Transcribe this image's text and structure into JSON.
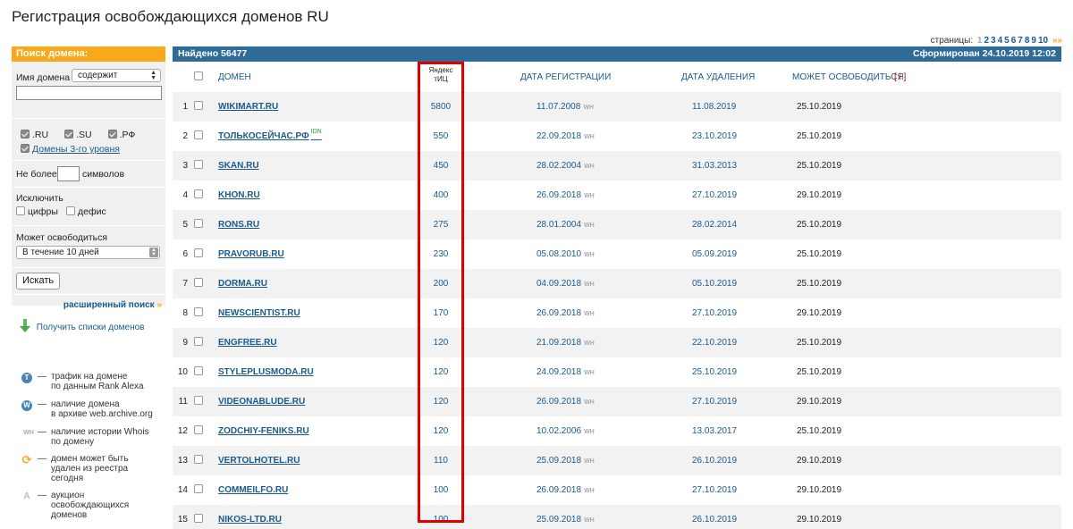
{
  "page": {
    "title": "Регистрация освобождающихся доменов RU"
  },
  "pager": {
    "label": "страницы:",
    "pages": [
      "1",
      "2",
      "3",
      "4",
      "5",
      "6",
      "7",
      "8",
      "9",
      "10"
    ],
    "current": "1",
    "next_icon": "»»"
  },
  "sidebar": {
    "header": "Поиск домена:",
    "domain_name_label": "Имя домена",
    "match_select": "содержит",
    "domain_input_value": "",
    "zones": [
      {
        "label": ".RU",
        "checked": true
      },
      {
        "label": ".SU",
        "checked": true
      },
      {
        "label": ".РФ",
        "checked": true
      }
    ],
    "third_level": {
      "label": "Домены 3-го уровня",
      "checked": true
    },
    "max_chars_prefix": "Не более",
    "max_chars_suffix": "символов",
    "max_chars_value": "",
    "exclude_label": "Исключить",
    "exclude_digits": "цифры",
    "exclude_hyphen": "дефис",
    "may_free_label": "Может освободиться",
    "period_select": "В течение 10 дней",
    "search_button": "Искать",
    "advanced_link": "расширенный поиск",
    "advanced_icon": "»",
    "download_link": "Получить списки доменов"
  },
  "legend": [
    {
      "icon": "T",
      "icon_name": "traffic-icon",
      "text": [
        "трафик на домене",
        "по данным Rank Alexa"
      ]
    },
    {
      "icon": "W",
      "icon_name": "archive-icon",
      "text": [
        "наличие домена",
        "в архиве web.archive.org"
      ]
    },
    {
      "icon": "WH",
      "icon_name": "whois-history-icon",
      "text": [
        "наличие истории Whois",
        "по домену"
      ]
    },
    {
      "icon": "⟳",
      "icon_name": "deleted-today-icon",
      "text": [
        "домен может быть",
        "удален из реестра",
        "сегодня"
      ]
    },
    {
      "icon": "A",
      "icon_name": "auction-icon",
      "text": [
        "аукцион",
        "освобождающихся",
        "доменов"
      ]
    }
  ],
  "legend_dash": "—",
  "results": {
    "found": "Найдено 56477",
    "generated": "Сформирован 24.10.2019 12:02",
    "headers": {
      "domain": "ДОМЕН",
      "tic_line1": "Яндекс",
      "tic_line2": "тИЦ",
      "reg_date": "ДАТА РЕГИСТРАЦИИ",
      "del_date": "ДАТА УДАЛЕНИЯ",
      "may_free": "МОЖЕТ ОСВОБОДИТЬСЯ",
      "info": "[ i ]"
    },
    "wh_badge": "WH",
    "rows": [
      {
        "n": "1",
        "domain": "WIKIMART.RU",
        "idn": "",
        "tic": "5800",
        "reg": "11.07.2008",
        "del": "11.08.2019",
        "free": "25.10.2019"
      },
      {
        "n": "2",
        "domain": "ТОЛЬКОСЕЙЧАС.РФ",
        "idn": "idn",
        "tic": "550",
        "reg": "22.09.2018",
        "del": "23.10.2019",
        "free": "25.10.2019"
      },
      {
        "n": "3",
        "domain": "SKAN.RU",
        "idn": "",
        "tic": "450",
        "reg": "28.02.2004",
        "del": "31.03.2013",
        "free": "25.10.2019"
      },
      {
        "n": "4",
        "domain": "KHON.RU",
        "idn": "",
        "tic": "400",
        "reg": "26.09.2018",
        "del": "27.10.2019",
        "free": "29.10.2019"
      },
      {
        "n": "5",
        "domain": "RONS.RU",
        "idn": "",
        "tic": "275",
        "reg": "28.01.2004",
        "del": "28.02.2014",
        "free": "25.10.2019"
      },
      {
        "n": "6",
        "domain": "PRAVORUB.RU",
        "idn": "",
        "tic": "230",
        "reg": "05.08.2010",
        "del": "05.09.2019",
        "free": "25.10.2019"
      },
      {
        "n": "7",
        "domain": "DORMA.RU",
        "idn": "",
        "tic": "200",
        "reg": "04.09.2018",
        "del": "05.10.2019",
        "free": "25.10.2019"
      },
      {
        "n": "8",
        "domain": "NEWSCIENTIST.RU",
        "idn": "",
        "tic": "170",
        "reg": "26.09.2018",
        "del": "27.10.2019",
        "free": "29.10.2019"
      },
      {
        "n": "9",
        "domain": "ENGFREE.RU",
        "idn": "",
        "tic": "120",
        "reg": "21.09.2018",
        "del": "22.10.2019",
        "free": "25.10.2019"
      },
      {
        "n": "10",
        "domain": "STYLEPLUSMODA.RU",
        "idn": "",
        "tic": "120",
        "reg": "24.09.2018",
        "del": "25.10.2019",
        "free": "25.10.2019"
      },
      {
        "n": "11",
        "domain": "VIDEONABLUDE.RU",
        "idn": "",
        "tic": "120",
        "reg": "26.09.2018",
        "del": "27.10.2019",
        "free": "29.10.2019"
      },
      {
        "n": "12",
        "domain": "ZODCHIY-FENIKS.RU",
        "idn": "",
        "tic": "120",
        "reg": "10.02.2006",
        "del": "13.03.2017",
        "free": "25.10.2019"
      },
      {
        "n": "13",
        "domain": "VERTOLHOTEL.RU",
        "idn": "",
        "tic": "110",
        "reg": "25.09.2018",
        "del": "26.10.2019",
        "free": "29.10.2019"
      },
      {
        "n": "14",
        "domain": "COMMEILFO.RU",
        "idn": "",
        "tic": "100",
        "reg": "26.09.2018",
        "del": "27.10.2019",
        "free": "29.10.2019"
      },
      {
        "n": "15",
        "domain": "NIKOS-LTD.RU",
        "idn": "",
        "tic": "100",
        "reg": "25.09.2018",
        "del": "26.10.2019",
        "free": "29.10.2019"
      }
    ]
  },
  "colors": {
    "accent_orange": "#f7a81b",
    "bar_blue": "#2f6b97",
    "link_blue": "#1a5a8a",
    "highlight_red": "#e10000"
  }
}
